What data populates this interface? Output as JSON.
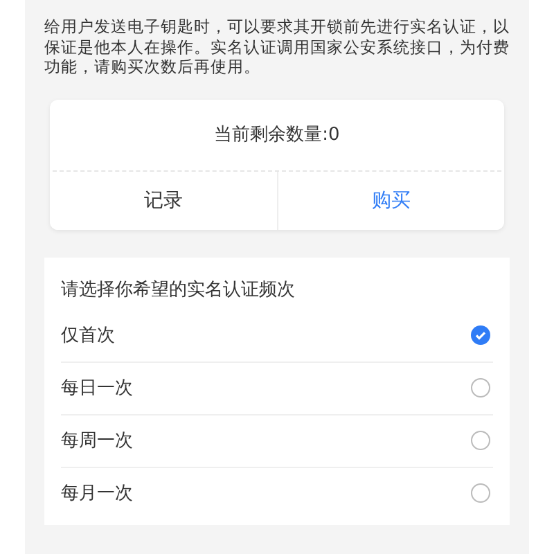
{
  "intro": "给用户发送电子钥匙时，可以要求其开锁前先进行实名认证，以保证是他本人在操作。实名认证调用国家公安系统接口，为付费功能，请购买次数后再使用。",
  "balance": {
    "text": "当前剩余数量:0",
    "actions": [
      {
        "label": "记录",
        "kind": "plain"
      },
      {
        "label": "购买",
        "kind": "primary"
      }
    ]
  },
  "frequency": {
    "title": "请选择你希望的实名认证频次",
    "options": [
      {
        "label": "仅首次",
        "selected": true
      },
      {
        "label": "每日一次",
        "selected": false
      },
      {
        "label": "每周一次",
        "selected": false
      },
      {
        "label": "每月一次",
        "selected": false
      }
    ]
  }
}
